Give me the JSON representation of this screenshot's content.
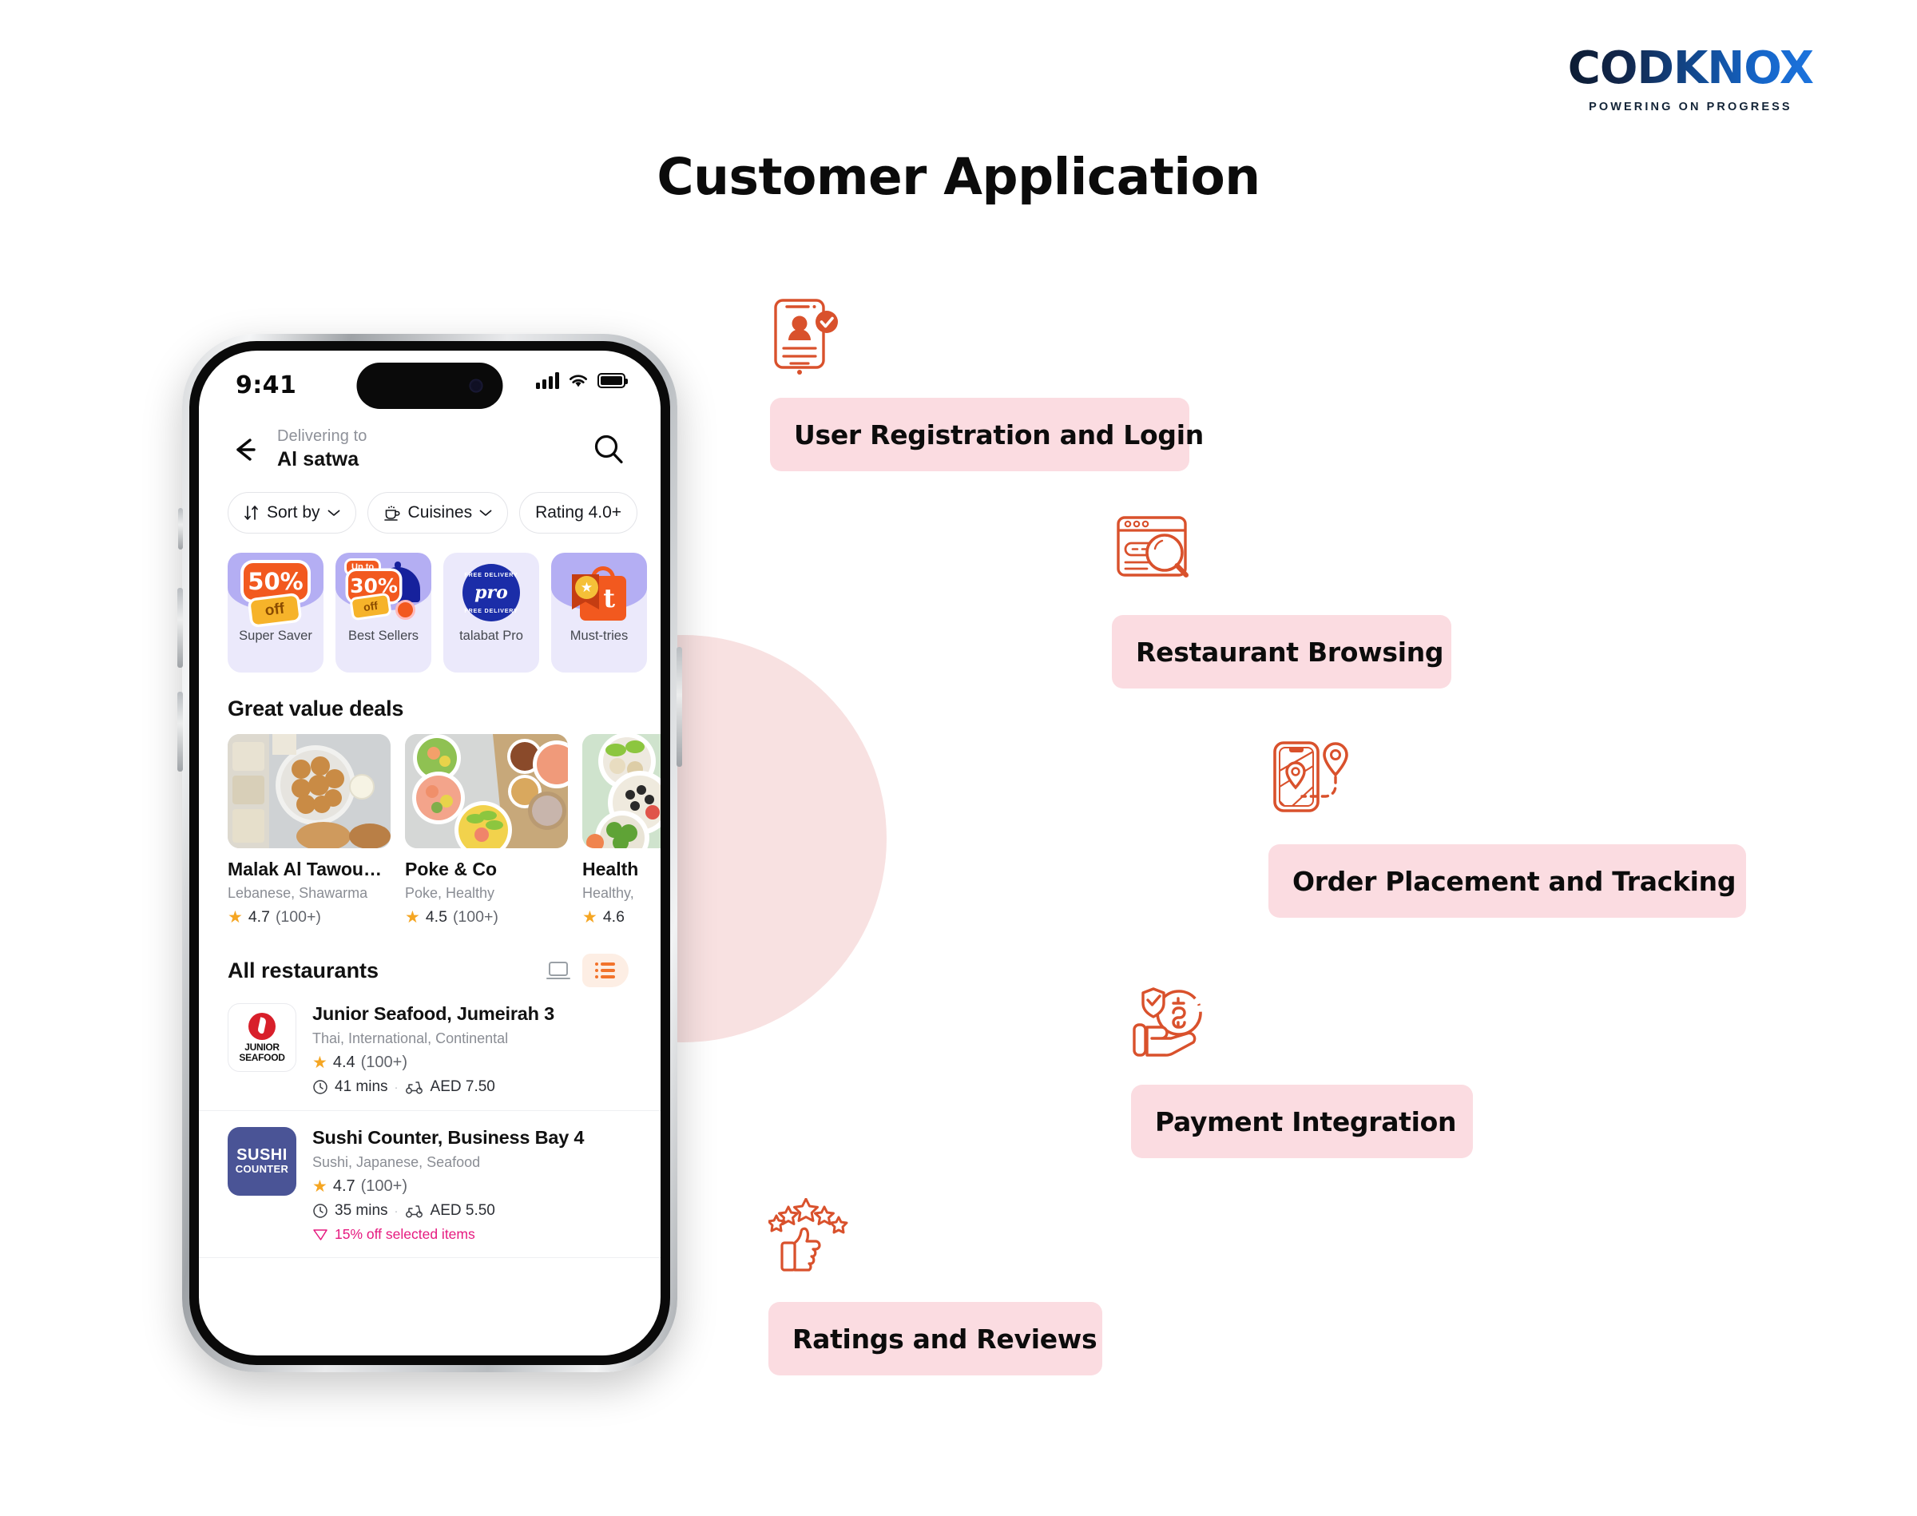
{
  "brand": {
    "name_part1": "C",
    "name_part2": "DKN",
    "name_part3": "X",
    "full_name": "CODKNOX",
    "tagline": "POWERING ON PROGRESS"
  },
  "page": {
    "title": "Customer Application"
  },
  "phone": {
    "status_bar": {
      "time": "9:41",
      "signal_icon": "cellular-signal-icon",
      "wifi_icon": "wifi-icon",
      "battery_icon": "battery-icon"
    },
    "header": {
      "back_icon": "back-arrow-icon",
      "delivering_label": "Delivering to",
      "delivering_value": "Al satwa",
      "search_icon": "search-icon"
    },
    "filters": [
      {
        "label": "Sort by",
        "icon": "sort-icon",
        "has_chevron": true
      },
      {
        "label": "Cuisines",
        "icon": "cup-icon",
        "has_chevron": true
      },
      {
        "label": "Rating 4.0+",
        "icon": "",
        "has_chevron": false
      }
    ],
    "promos": [
      {
        "caption": "Super Saver",
        "badge_pct": "50",
        "badge_sym": "%",
        "badge_off": "off",
        "art": "fifty-percent-off-badge"
      },
      {
        "caption": "Best Sellers",
        "badge_upto": "Up to",
        "badge_pct": "30",
        "badge_sym": "%",
        "badge_off": "off",
        "art": "best-sellers-dome"
      },
      {
        "caption": "talabat Pro",
        "pro_text": "pro",
        "pro_ring": "FREE DELIVERY",
        "art": "talabat-pro-badge"
      },
      {
        "caption": "Must-tries",
        "bag_letter": "t",
        "art": "must-tries-bag"
      }
    ],
    "deals_section": {
      "title": "Great value deals",
      "cards": [
        {
          "name": "Malak Al Tawouk, R...",
          "cuisine": "Lebanese, Shawarma",
          "rating": "4.7",
          "count": "(100+)",
          "image": "falafel-platter-photo"
        },
        {
          "name": "Poke & Co",
          "cuisine": "Poke, Healthy",
          "rating": "4.5",
          "count": "(100+)",
          "image": "poke-bowls-photo"
        },
        {
          "name": "Health",
          "cuisine": "Healthy,",
          "rating": "4.6",
          "count": "",
          "image": "healthy-bowls-photo"
        }
      ]
    },
    "all_section": {
      "title": "All restaurants",
      "view_grid_icon": "grid-view-icon",
      "view_list_icon": "list-view-icon",
      "active_view": "list",
      "restaurants": [
        {
          "logo_line1": "JUNIOR",
          "logo_line2": "SEAFOOD",
          "name": "Junior Seafood, Jumeirah 3",
          "cuisine": "Thai, International, Continental",
          "rating": "4.4",
          "count": "(100+)",
          "time": "41 mins",
          "fee": "AED 7.50",
          "discount": ""
        },
        {
          "logo_line1": "SUSHI",
          "logo_line2": "COUNTER",
          "name": "Sushi Counter, Business Bay 4",
          "cuisine": "Sushi, Japanese, Seafood",
          "rating": "4.7",
          "count": "(100+)",
          "time": "35 mins",
          "fee": "AED 5.50",
          "discount": "15% off selected items"
        }
      ]
    }
  },
  "features": [
    {
      "label": "User Registration and Login",
      "icon": "id-card-verified-icon"
    },
    {
      "label": "Restaurant Browsing",
      "icon": "browser-search-icon"
    },
    {
      "label": "Order Placement and Tracking",
      "icon": "map-tracking-icon"
    },
    {
      "label": "Payment Integration",
      "icon": "secure-payment-hand-icon"
    },
    {
      "label": "Ratings and Reviews",
      "icon": "thumbs-up-stars-icon"
    }
  ],
  "colors": {
    "accent_orange": "#D9512C",
    "pill_pink": "#FBDCE1",
    "circle_pink": "#F8E1E1",
    "promo_purple": "#B4AEF3",
    "promo_bg": "#EBE9FB",
    "star_gold": "#F5A623",
    "discount_pink": "#E6197F",
    "brand_blue": "#1565C8"
  }
}
